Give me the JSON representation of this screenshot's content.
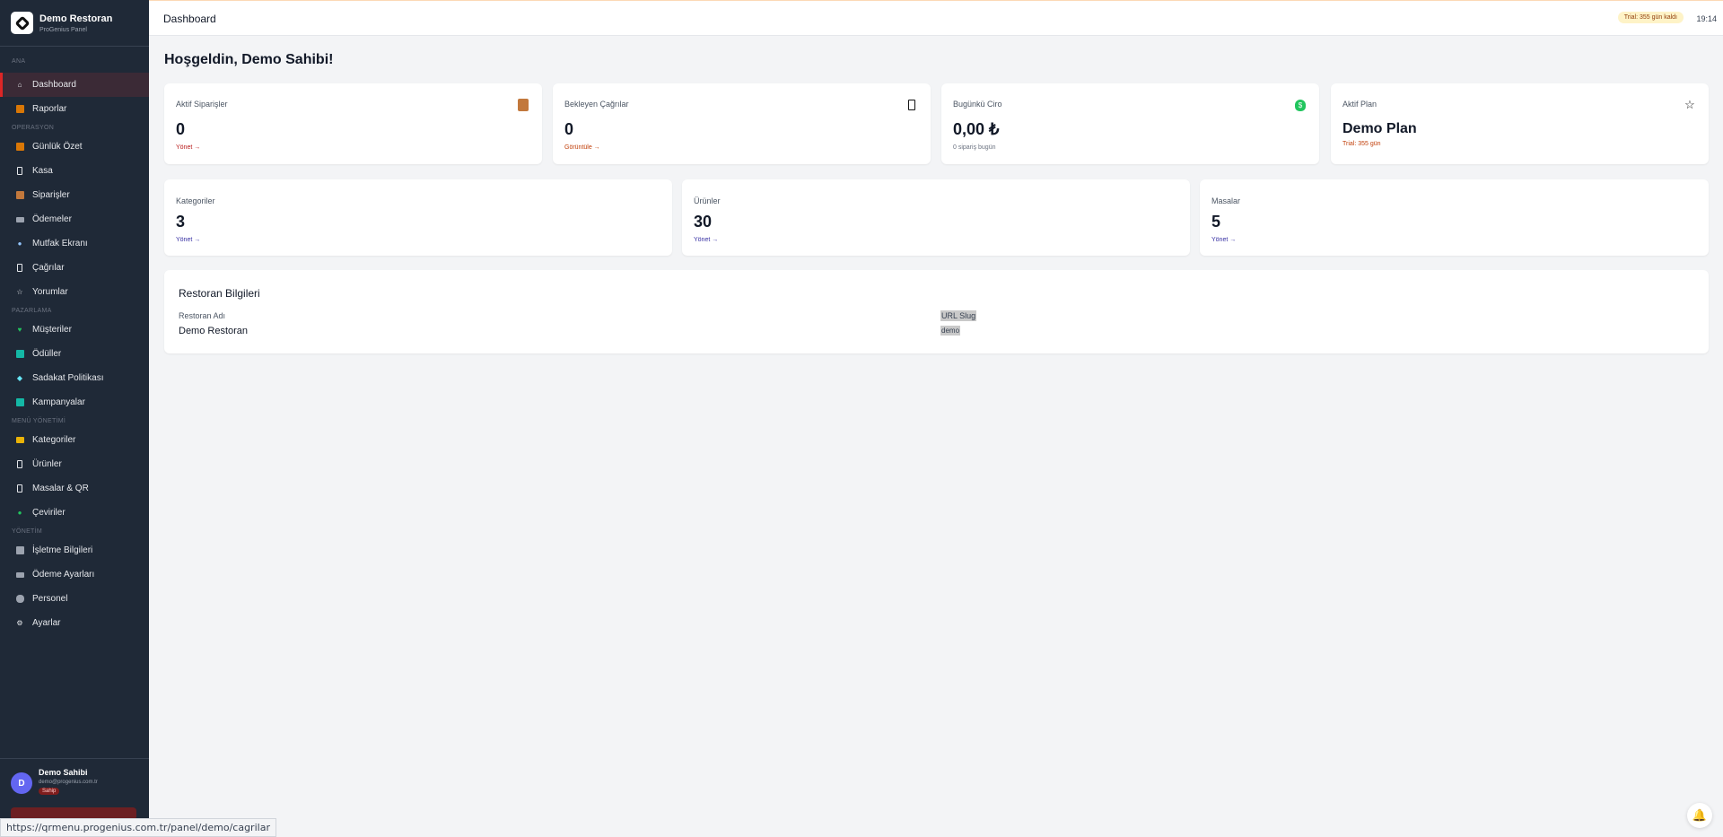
{
  "brand": {
    "name": "Demo Restoran",
    "sub": "ProGenius Panel"
  },
  "sidebar": {
    "sections": [
      {
        "title": "ANA",
        "items": [
          {
            "label": "Dashboard",
            "icon": "home-icon"
          },
          {
            "label": "Raporlar",
            "icon": "chart-icon"
          }
        ]
      },
      {
        "title": "OPERASYON",
        "items": [
          {
            "label": "Günlük Özet",
            "icon": "summary-icon"
          },
          {
            "label": "Kasa",
            "icon": "register-icon"
          },
          {
            "label": "Siparişler",
            "icon": "clipboard-icon"
          },
          {
            "label": "Ödemeler",
            "icon": "card-icon"
          },
          {
            "label": "Mutfak Ekranı",
            "icon": "chef-icon"
          },
          {
            "label": "Çağrılar",
            "icon": "phone-icon"
          },
          {
            "label": "Yorumlar",
            "icon": "star-icon"
          }
        ]
      },
      {
        "title": "PAZARLAMA",
        "items": [
          {
            "label": "Müşteriler",
            "icon": "heart-icon"
          },
          {
            "label": "Ödüller",
            "icon": "gift-icon"
          },
          {
            "label": "Sadakat Politikası",
            "icon": "diamond-icon"
          },
          {
            "label": "Kampanyalar",
            "icon": "gift-icon"
          }
        ]
      },
      {
        "title": "MENÜ YÖNETİMİ",
        "items": [
          {
            "label": "Kategoriler",
            "icon": "folder-icon"
          },
          {
            "label": "Ürünler",
            "icon": "phone-icon"
          },
          {
            "label": "Masalar & QR",
            "icon": "phone-icon"
          },
          {
            "label": "Çeviriler",
            "icon": "globe-icon"
          }
        ]
      },
      {
        "title": "YÖNETİM",
        "items": [
          {
            "label": "İşletme Bilgileri",
            "icon": "building-icon"
          },
          {
            "label": "Ödeme Ayarları",
            "icon": "card-icon"
          },
          {
            "label": "Personel",
            "icon": "people-icon"
          },
          {
            "label": "Ayarlar",
            "icon": "gear-icon"
          }
        ]
      }
    ],
    "user": {
      "initial": "D",
      "name": "Demo Sahibi",
      "email": "demo@progenius.com.tr",
      "role": "Sahip"
    }
  },
  "header": {
    "title": "Dashboard",
    "trial": "Trial: 355 gün kaldı",
    "time": "19:14"
  },
  "main": {
    "welcome": "Hoşgeldin, Demo Sahibi!",
    "stats": [
      {
        "label": "Aktif Siparişler",
        "value": "0",
        "link": "Yönet →",
        "link_color": "#b91c1c",
        "icon": "clipboard-icon"
      },
      {
        "label": "Bekleyen Çağrılar",
        "value": "0",
        "link": "Görüntüle →",
        "link_color": "#c2410c",
        "icon": "phone-icon"
      },
      {
        "label": "Bugünkü Ciro",
        "value": "0,00 ₺",
        "sub": "0 sipariş bugün",
        "icon": "money-bag-icon"
      },
      {
        "label": "Aktif Plan",
        "value": "Demo Plan",
        "sub": "Trial: 355 gün",
        "sub_color": "#c2410c",
        "icon": "star-icon"
      }
    ],
    "counts": [
      {
        "label": "Kategoriler",
        "value": "3",
        "link": "Yönet →"
      },
      {
        "label": "Ürünler",
        "value": "30",
        "link": "Yönet →"
      },
      {
        "label": "Masalar",
        "value": "5",
        "link": "Yönet →"
      }
    ],
    "info": {
      "title": "Restoran Bilgileri",
      "name_label": "Restoran Adı",
      "name_value": "Demo Restoran",
      "slug_label": "URL Slug",
      "slug_value": "demo"
    }
  },
  "statusbar": {
    "url": "https://qrmenu.progenius.com.tr/panel/demo/cagrilar"
  },
  "colors": {
    "sidebar_bg": "#1f2937",
    "active_accent": "#dc2626",
    "link_blue": "#3730a3",
    "avatar": "#6366f1"
  }
}
